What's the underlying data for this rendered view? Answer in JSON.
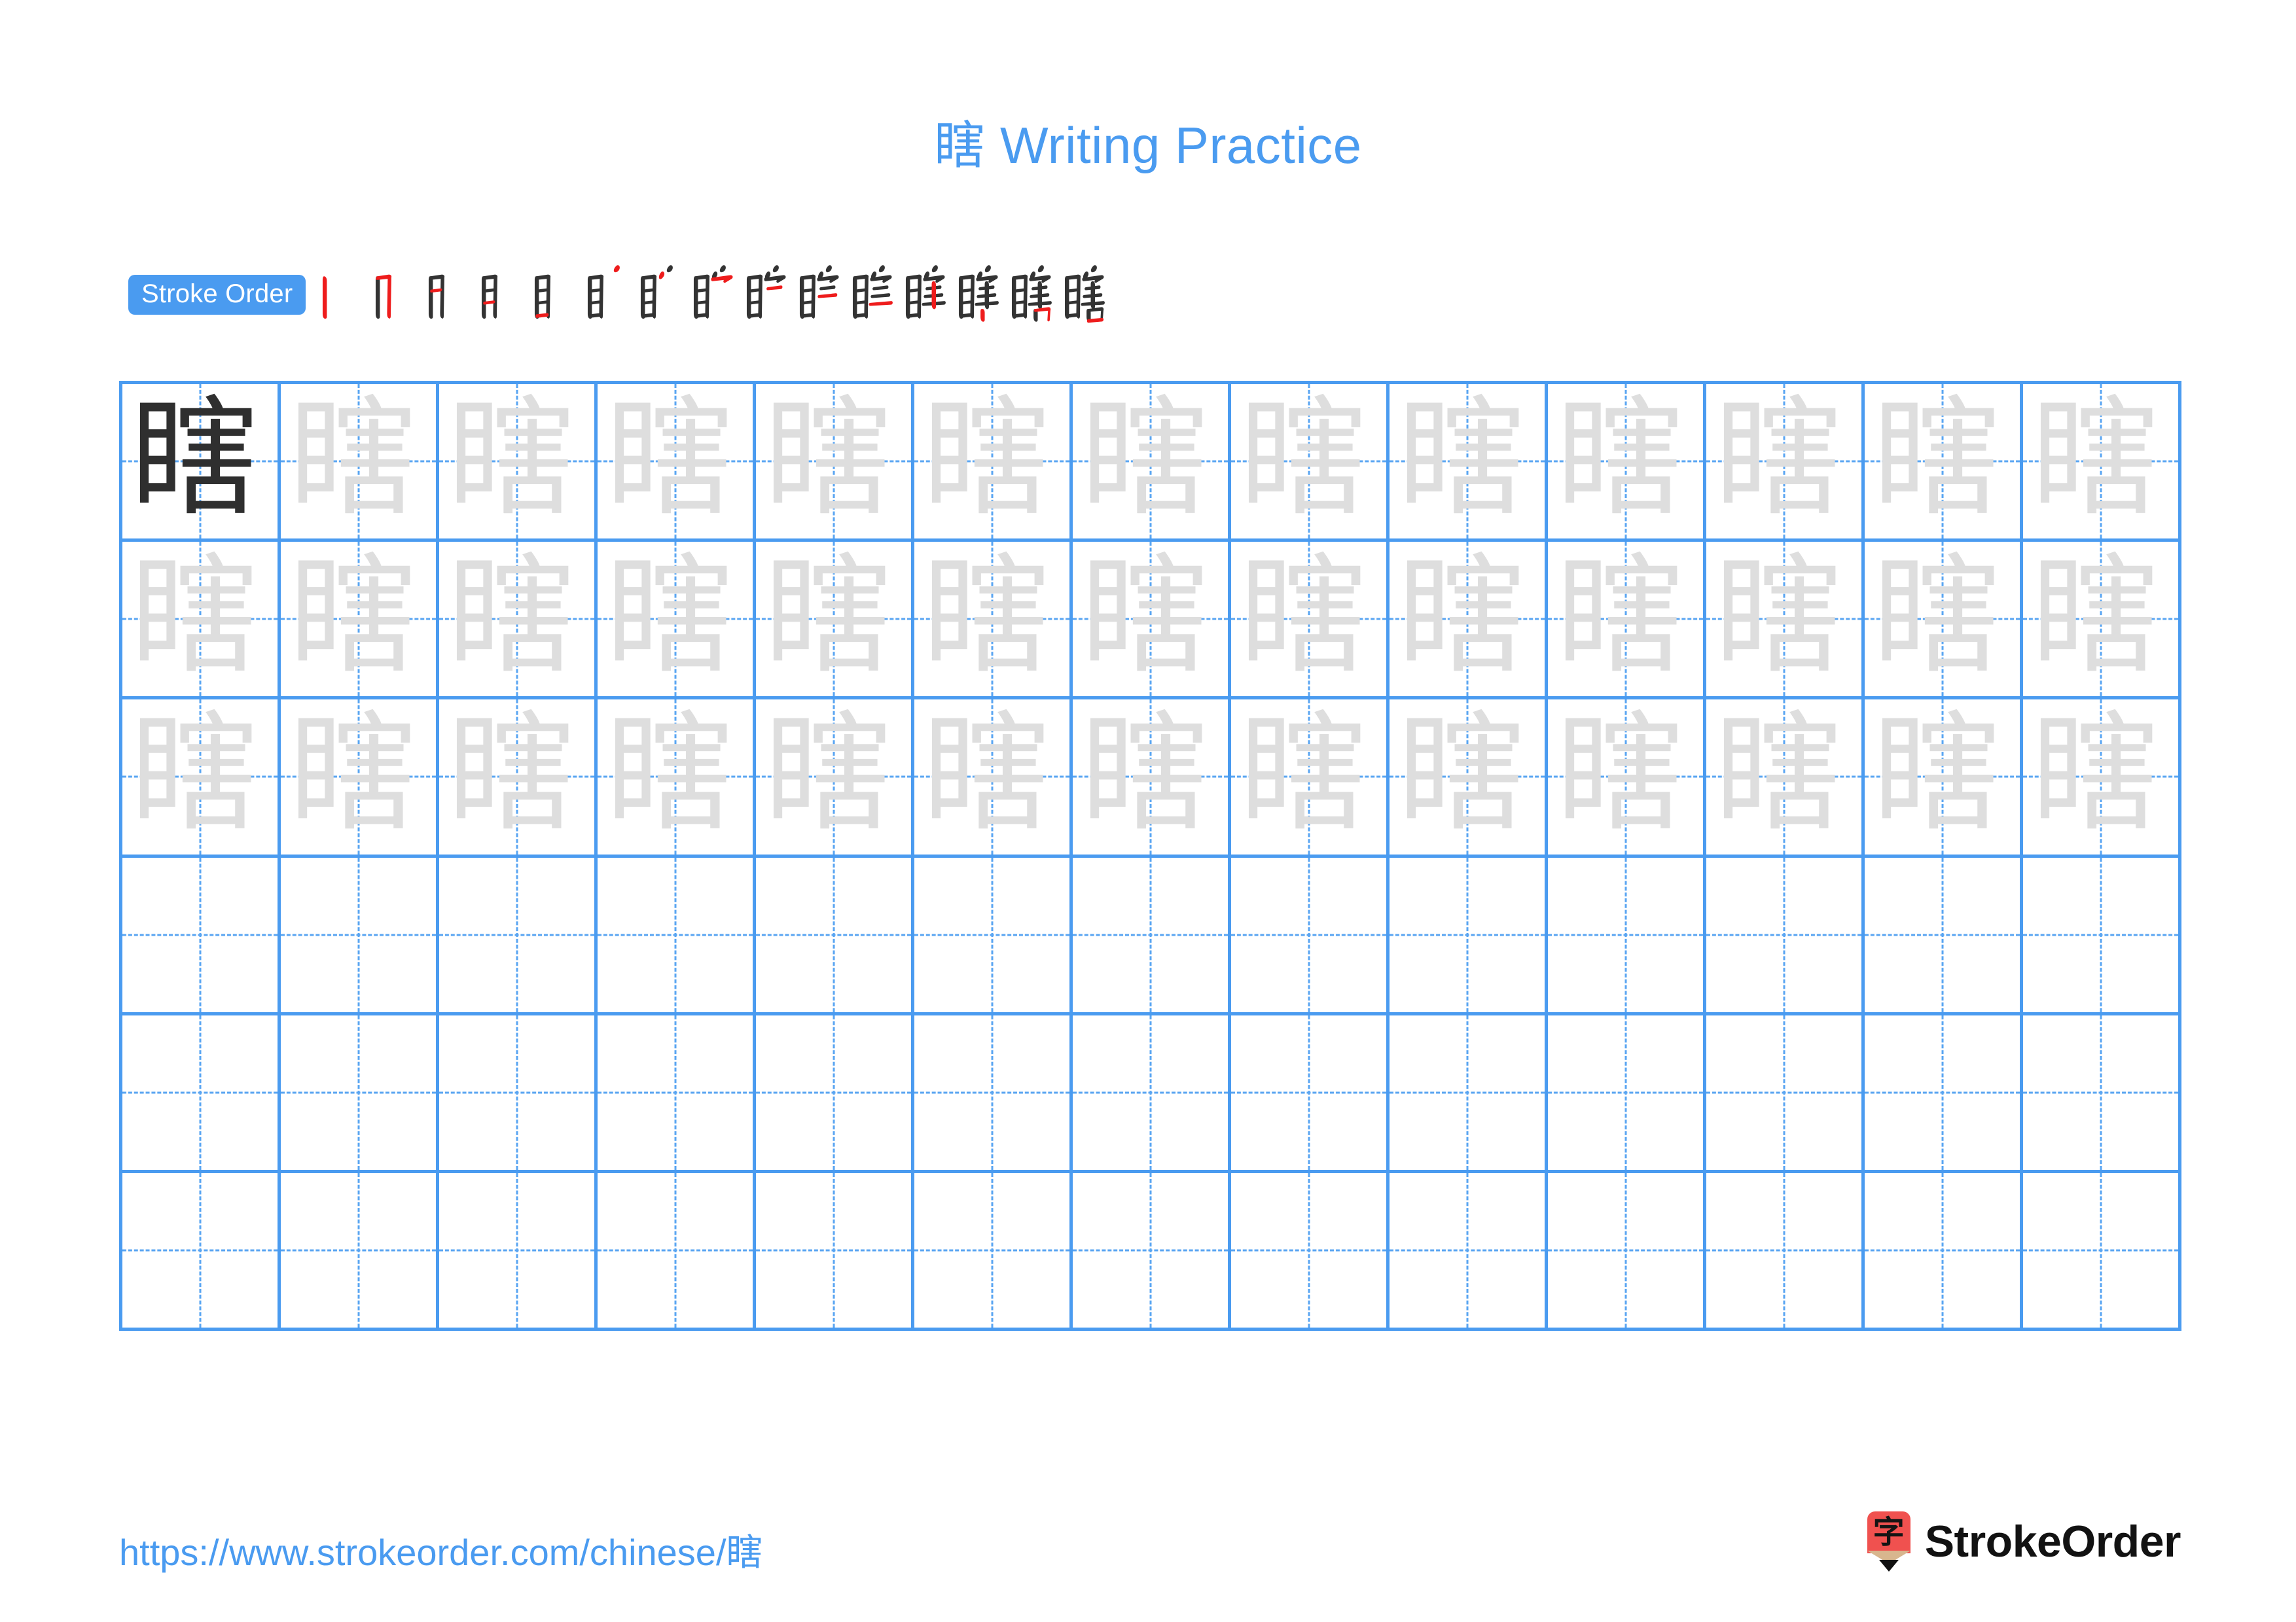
{
  "character": "瞎",
  "title": {
    "character": "瞎",
    "suffix": " Writing Practice",
    "color": "#4a9bf0"
  },
  "stroke_order": {
    "label": "Stroke Order",
    "badge_bg": "#4a9bf0",
    "badge_color": "#ffffff",
    "total_strokes": 15,
    "current_stroke_color": "#ee1c1c",
    "previous_stroke_color": "#333333",
    "steps": [
      {
        "index": 1,
        "strokes_drawn": 1,
        "new_stroke": "vertical (shu) left side of 目"
      },
      {
        "index": 2,
        "strokes_drawn": 2,
        "new_stroke": "horizontal-fold-vertical (heng zhe gou) of 目"
      },
      {
        "index": 3,
        "strokes_drawn": 3,
        "new_stroke": "upper inner horizontal of 目"
      },
      {
        "index": 4,
        "strokes_drawn": 4,
        "new_stroke": "lower inner horizontal of 目"
      },
      {
        "index": 5,
        "strokes_drawn": 5,
        "new_stroke": "bottom horizontal of 目"
      },
      {
        "index": 6,
        "strokes_drawn": 6,
        "new_stroke": "dot (dian) top of 宀"
      },
      {
        "index": 7,
        "strokes_drawn": 7,
        "new_stroke": "left dot (dian) of 宀"
      },
      {
        "index": 8,
        "strokes_drawn": 8,
        "new_stroke": "horizontal-hook (heng gou) of 宀"
      },
      {
        "index": 9,
        "strokes_drawn": 9,
        "new_stroke": "first horizontal under 宀"
      },
      {
        "index": 10,
        "strokes_drawn": 10,
        "new_stroke": "second horizontal"
      },
      {
        "index": 11,
        "strokes_drawn": 11,
        "new_stroke": "third horizontal"
      },
      {
        "index": 12,
        "strokes_drawn": 12,
        "new_stroke": "vertical (shu) through horizontals"
      },
      {
        "index": 13,
        "strokes_drawn": 13,
        "new_stroke": "left-falling short stroke of 口"
      },
      {
        "index": 14,
        "strokes_drawn": 14,
        "new_stroke": "horizontal-fold of 口"
      },
      {
        "index": 15,
        "strokes_drawn": 15,
        "new_stroke": "closing horizontal of 口"
      }
    ]
  },
  "grid": {
    "columns": 13,
    "rows": 6,
    "border_color": "#4a9bf0",
    "guide_color": "#59a5f2",
    "model_color": "#2f2f2f",
    "trace_color": "#dedede",
    "cells": [
      [
        "model",
        "trace",
        "trace",
        "trace",
        "trace",
        "trace",
        "trace",
        "trace",
        "trace",
        "trace",
        "trace",
        "trace",
        "trace"
      ],
      [
        "trace",
        "trace",
        "trace",
        "trace",
        "trace",
        "trace",
        "trace",
        "trace",
        "trace",
        "trace",
        "trace",
        "trace",
        "trace"
      ],
      [
        "trace",
        "trace",
        "trace",
        "trace",
        "trace",
        "trace",
        "trace",
        "trace",
        "trace",
        "trace",
        "trace",
        "trace",
        "trace"
      ],
      [
        "blank",
        "blank",
        "blank",
        "blank",
        "blank",
        "blank",
        "blank",
        "blank",
        "blank",
        "blank",
        "blank",
        "blank",
        "blank"
      ],
      [
        "blank",
        "blank",
        "blank",
        "blank",
        "blank",
        "blank",
        "blank",
        "blank",
        "blank",
        "blank",
        "blank",
        "blank",
        "blank"
      ],
      [
        "blank",
        "blank",
        "blank",
        "blank",
        "blank",
        "blank",
        "blank",
        "blank",
        "blank",
        "blank",
        "blank",
        "blank",
        "blank"
      ]
    ]
  },
  "footer": {
    "url": "https://www.strokeorder.com/chinese/瞎",
    "url_color": "#4a9bf0",
    "brand_name": "StrokeOrder",
    "brand_mark_character": "字",
    "brand_mark_color": "#f0514f",
    "brand_mark_wood_color": "#d8b68e",
    "brand_mark_tip_color": "#111111"
  }
}
